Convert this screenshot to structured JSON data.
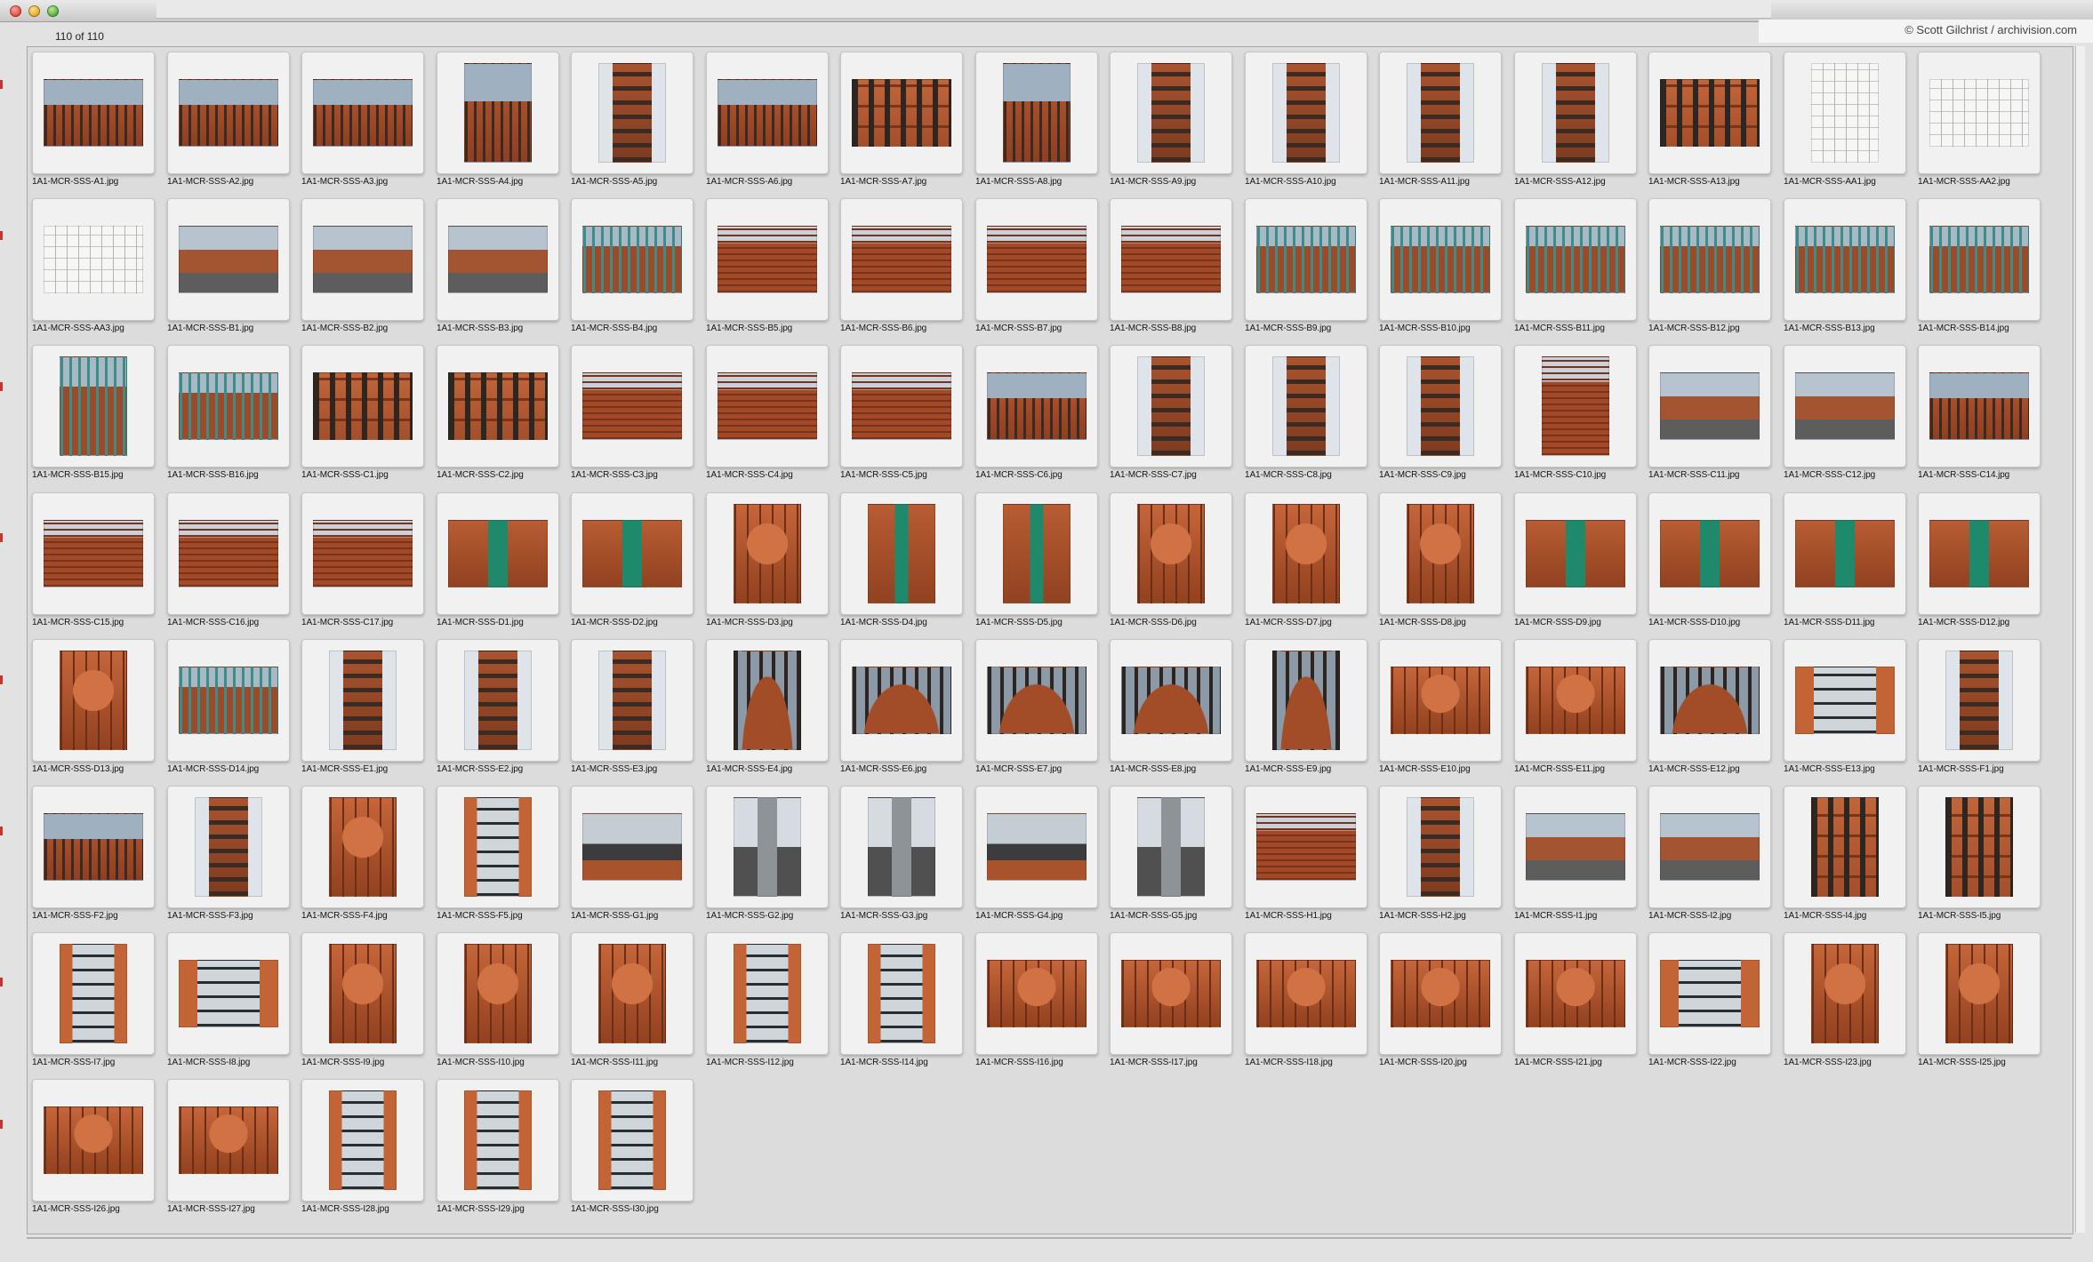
{
  "window": {
    "counter": "110 of 110",
    "credit": "© Scott Gilchrist / archivision.com"
  },
  "thumbnails": [
    {
      "file": "1A1-MCR-SSS-A1.jpg",
      "kind": "building",
      "orient": "wide"
    },
    {
      "file": "1A1-MCR-SSS-A2.jpg",
      "kind": "building",
      "orient": "wide"
    },
    {
      "file": "1A1-MCR-SSS-A3.jpg",
      "kind": "building",
      "orient": "wide"
    },
    {
      "file": "1A1-MCR-SSS-A4.jpg",
      "kind": "building",
      "orient": "tall"
    },
    {
      "file": "1A1-MCR-SSS-A5.jpg",
      "kind": "tower",
      "orient": "tall"
    },
    {
      "file": "1A1-MCR-SSS-A6.jpg",
      "kind": "building",
      "orient": "wide"
    },
    {
      "file": "1A1-MCR-SSS-A7.jpg",
      "kind": "facade",
      "orient": "wide"
    },
    {
      "file": "1A1-MCR-SSS-A8.jpg",
      "kind": "building",
      "orient": "tall"
    },
    {
      "file": "1A1-MCR-SSS-A9.jpg",
      "kind": "tower",
      "orient": "tall"
    },
    {
      "file": "1A1-MCR-SSS-A10.jpg",
      "kind": "tower",
      "orient": "tall"
    },
    {
      "file": "1A1-MCR-SSS-A11.jpg",
      "kind": "tower",
      "orient": "tall"
    },
    {
      "file": "1A1-MCR-SSS-A12.jpg",
      "kind": "tower",
      "orient": "tall"
    },
    {
      "file": "1A1-MCR-SSS-A13.jpg",
      "kind": "facade",
      "orient": "wide"
    },
    {
      "file": "1A1-MCR-SSS-AA1.jpg",
      "kind": "drawing",
      "orient": "tall"
    },
    {
      "file": "1A1-MCR-SSS-AA2.jpg",
      "kind": "drawing",
      "orient": "wide"
    },
    {
      "file": "1A1-MCR-SSS-AA3.jpg",
      "kind": "drawing",
      "orient": "wide"
    },
    {
      "file": "1A1-MCR-SSS-B1.jpg",
      "kind": "street",
      "orient": "wide"
    },
    {
      "file": "1A1-MCR-SSS-B2.jpg",
      "kind": "street",
      "orient": "wide"
    },
    {
      "file": "1A1-MCR-SSS-B3.jpg",
      "kind": "street",
      "orient": "wide"
    },
    {
      "file": "1A1-MCR-SSS-B4.jpg",
      "kind": "gate",
      "orient": "wide"
    },
    {
      "file": "1A1-MCR-SSS-B5.jpg",
      "kind": "wall",
      "orient": "wide"
    },
    {
      "file": "1A1-MCR-SSS-B6.jpg",
      "kind": "wall",
      "orient": "wide"
    },
    {
      "file": "1A1-MCR-SSS-B7.jpg",
      "kind": "wall",
      "orient": "wide"
    },
    {
      "file": "1A1-MCR-SSS-B8.jpg",
      "kind": "wall",
      "orient": "wide"
    },
    {
      "file": "1A1-MCR-SSS-B9.jpg",
      "kind": "gate",
      "orient": "wide"
    },
    {
      "file": "1A1-MCR-SSS-B10.jpg",
      "kind": "gate",
      "orient": "wide"
    },
    {
      "file": "1A1-MCR-SSS-B11.jpg",
      "kind": "gate",
      "orient": "wide"
    },
    {
      "file": "1A1-MCR-SSS-B12.jpg",
      "kind": "gate",
      "orient": "wide"
    },
    {
      "file": "1A1-MCR-SSS-B13.jpg",
      "kind": "gate",
      "orient": "wide"
    },
    {
      "file": "1A1-MCR-SSS-B14.jpg",
      "kind": "gate",
      "orient": "wide"
    },
    {
      "file": "1A1-MCR-SSS-B15.jpg",
      "kind": "gate",
      "orient": "tall"
    },
    {
      "file": "1A1-MCR-SSS-B16.jpg",
      "kind": "gate",
      "orient": "wide"
    },
    {
      "file": "1A1-MCR-SSS-C1.jpg",
      "kind": "facade",
      "orient": "wide"
    },
    {
      "file": "1A1-MCR-SSS-C2.jpg",
      "kind": "facade",
      "orient": "wide"
    },
    {
      "file": "1A1-MCR-SSS-C3.jpg",
      "kind": "wall",
      "orient": "wide"
    },
    {
      "file": "1A1-MCR-SSS-C4.jpg",
      "kind": "wall",
      "orient": "wide"
    },
    {
      "file": "1A1-MCR-SSS-C5.jpg",
      "kind": "wall",
      "orient": "wide"
    },
    {
      "file": "1A1-MCR-SSS-C6.jpg",
      "kind": "building",
      "orient": "wide"
    },
    {
      "file": "1A1-MCR-SSS-C7.jpg",
      "kind": "tower",
      "orient": "tall"
    },
    {
      "file": "1A1-MCR-SSS-C8.jpg",
      "kind": "tower",
      "orient": "tall"
    },
    {
      "file": "1A1-MCR-SSS-C9.jpg",
      "kind": "tower",
      "orient": "tall"
    },
    {
      "file": "1A1-MCR-SSS-C10.jpg",
      "kind": "wall",
      "orient": "tall"
    },
    {
      "file": "1A1-MCR-SSS-C11.jpg",
      "kind": "street",
      "orient": "wide"
    },
    {
      "file": "1A1-MCR-SSS-C12.jpg",
      "kind": "street",
      "orient": "wide"
    },
    {
      "file": "1A1-MCR-SSS-C14.jpg",
      "kind": "building",
      "orient": "wide"
    },
    {
      "file": "1A1-MCR-SSS-C15.jpg",
      "kind": "wall",
      "orient": "wide"
    },
    {
      "file": "1A1-MCR-SSS-C16.jpg",
      "kind": "wall",
      "orient": "wide"
    },
    {
      "file": "1A1-MCR-SSS-C17.jpg",
      "kind": "wall",
      "orient": "wide"
    },
    {
      "file": "1A1-MCR-SSS-D1.jpg",
      "kind": "door",
      "orient": "wide"
    },
    {
      "file": "1A1-MCR-SSS-D2.jpg",
      "kind": "door",
      "orient": "wide"
    },
    {
      "file": "1A1-MCR-SSS-D3.jpg",
      "kind": "detail",
      "orient": "tall"
    },
    {
      "file": "1A1-MCR-SSS-D4.jpg",
      "kind": "door",
      "orient": "tall"
    },
    {
      "file": "1A1-MCR-SSS-D5.jpg",
      "kind": "door",
      "orient": "tall"
    },
    {
      "file": "1A1-MCR-SSS-D6.jpg",
      "kind": "detail",
      "orient": "tall"
    },
    {
      "file": "1A1-MCR-SSS-D7.jpg",
      "kind": "detail",
      "orient": "tall"
    },
    {
      "file": "1A1-MCR-SSS-D8.jpg",
      "kind": "detail",
      "orient": "tall"
    },
    {
      "file": "1A1-MCR-SSS-D9.jpg",
      "kind": "door",
      "orient": "wide"
    },
    {
      "file": "1A1-MCR-SSS-D10.jpg",
      "kind": "door",
      "orient": "wide"
    },
    {
      "file": "1A1-MCR-SSS-D11.jpg",
      "kind": "door",
      "orient": "wide"
    },
    {
      "file": "1A1-MCR-SSS-D12.jpg",
      "kind": "door",
      "orient": "wide"
    },
    {
      "file": "1A1-MCR-SSS-D13.jpg",
      "kind": "detail",
      "orient": "tall"
    },
    {
      "file": "1A1-MCR-SSS-D14.jpg",
      "kind": "gate",
      "orient": "wide"
    },
    {
      "file": "1A1-MCR-SSS-E1.jpg",
      "kind": "tower",
      "orient": "tall"
    },
    {
      "file": "1A1-MCR-SSS-E2.jpg",
      "kind": "tower",
      "orient": "tall"
    },
    {
      "file": "1A1-MCR-SSS-E3.jpg",
      "kind": "tower",
      "orient": "tall"
    },
    {
      "file": "1A1-MCR-SSS-E4.jpg",
      "kind": "round",
      "orient": "tall"
    },
    {
      "file": "1A1-MCR-SSS-E6.jpg",
      "kind": "round",
      "orient": "wide"
    },
    {
      "file": "1A1-MCR-SSS-E7.jpg",
      "kind": "round",
      "orient": "wide"
    },
    {
      "file": "1A1-MCR-SSS-E8.jpg",
      "kind": "round",
      "orient": "wide"
    },
    {
      "file": "1A1-MCR-SSS-E9.jpg",
      "kind": "round",
      "orient": "tall"
    },
    {
      "file": "1A1-MCR-SSS-E10.jpg",
      "kind": "detail",
      "orient": "wide"
    },
    {
      "file": "1A1-MCR-SSS-E11.jpg",
      "kind": "detail",
      "orient": "wide"
    },
    {
      "file": "1A1-MCR-SSS-E12.jpg",
      "kind": "round",
      "orient": "wide"
    },
    {
      "file": "1A1-MCR-SSS-E13.jpg",
      "kind": "window",
      "orient": "wide"
    },
    {
      "file": "1A1-MCR-SSS-F1.jpg",
      "kind": "tower",
      "orient": "tall"
    },
    {
      "file": "1A1-MCR-SSS-F2.jpg",
      "kind": "building",
      "orient": "wide"
    },
    {
      "file": "1A1-MCR-SSS-F3.jpg",
      "kind": "tower",
      "orient": "tall"
    },
    {
      "file": "1A1-MCR-SSS-F4.jpg",
      "kind": "detail",
      "orient": "tall"
    },
    {
      "file": "1A1-MCR-SSS-F5.jpg",
      "kind": "window",
      "orient": "tall"
    },
    {
      "file": "1A1-MCR-SSS-G1.jpg",
      "kind": "roof",
      "orient": "wide"
    },
    {
      "file": "1A1-MCR-SSS-G2.jpg",
      "kind": "vent",
      "orient": "tall"
    },
    {
      "file": "1A1-MCR-SSS-G3.jpg",
      "kind": "vent",
      "orient": "tall"
    },
    {
      "file": "1A1-MCR-SSS-G4.jpg",
      "kind": "roof",
      "orient": "wide"
    },
    {
      "file": "1A1-MCR-SSS-G5.jpg",
      "kind": "vent",
      "orient": "tall"
    },
    {
      "file": "1A1-MCR-SSS-H1.jpg",
      "kind": "wall",
      "orient": "wide"
    },
    {
      "file": "1A1-MCR-SSS-H2.jpg",
      "kind": "tower",
      "orient": "tall"
    },
    {
      "file": "1A1-MCR-SSS-I1.jpg",
      "kind": "street",
      "orient": "wide"
    },
    {
      "file": "1A1-MCR-SSS-I2.jpg",
      "kind": "street",
      "orient": "wide"
    },
    {
      "file": "1A1-MCR-SSS-I4.jpg",
      "kind": "facade",
      "orient": "tall"
    },
    {
      "file": "1A1-MCR-SSS-I5.jpg",
      "kind": "facade",
      "orient": "tall"
    },
    {
      "file": "1A1-MCR-SSS-I7.jpg",
      "kind": "window",
      "orient": "tall"
    },
    {
      "file": "1A1-MCR-SSS-I8.jpg",
      "kind": "window",
      "orient": "wide"
    },
    {
      "file": "1A1-MCR-SSS-I9.jpg",
      "kind": "detail",
      "orient": "tall"
    },
    {
      "file": "1A1-MCR-SSS-I10.jpg",
      "kind": "detail",
      "orient": "tall"
    },
    {
      "file": "1A1-MCR-SSS-I11.jpg",
      "kind": "detail",
      "orient": "tall"
    },
    {
      "file": "1A1-MCR-SSS-I12.jpg",
      "kind": "window",
      "orient": "tall"
    },
    {
      "file": "1A1-MCR-SSS-I14.jpg",
      "kind": "window",
      "orient": "tall"
    },
    {
      "file": "1A1-MCR-SSS-I16.jpg",
      "kind": "detail",
      "orient": "wide"
    },
    {
      "file": "1A1-MCR-SSS-I17.jpg",
      "kind": "detail",
      "orient": "wide"
    },
    {
      "file": "1A1-MCR-SSS-I18.jpg",
      "kind": "detail",
      "orient": "wide"
    },
    {
      "file": "1A1-MCR-SSS-I20.jpg",
      "kind": "detail",
      "orient": "wide"
    },
    {
      "file": "1A1-MCR-SSS-I21.jpg",
      "kind": "detail",
      "orient": "wide"
    },
    {
      "file": "1A1-MCR-SSS-I22.jpg",
      "kind": "window",
      "orient": "wide"
    },
    {
      "file": "1A1-MCR-SSS-I23.jpg",
      "kind": "detail",
      "orient": "tall"
    },
    {
      "file": "1A1-MCR-SSS-I25.jpg",
      "kind": "detail",
      "orient": "tall"
    },
    {
      "file": "1A1-MCR-SSS-I26.jpg",
      "kind": "detail",
      "orient": "wide"
    },
    {
      "file": "1A1-MCR-SSS-I27.jpg",
      "kind": "detail",
      "orient": "wide"
    },
    {
      "file": "1A1-MCR-SSS-I28.jpg",
      "kind": "window",
      "orient": "tall"
    },
    {
      "file": "1A1-MCR-SSS-I29.jpg",
      "kind": "window",
      "orient": "tall"
    },
    {
      "file": "1A1-MCR-SSS-I30.jpg",
      "kind": "window",
      "orient": "tall"
    }
  ]
}
